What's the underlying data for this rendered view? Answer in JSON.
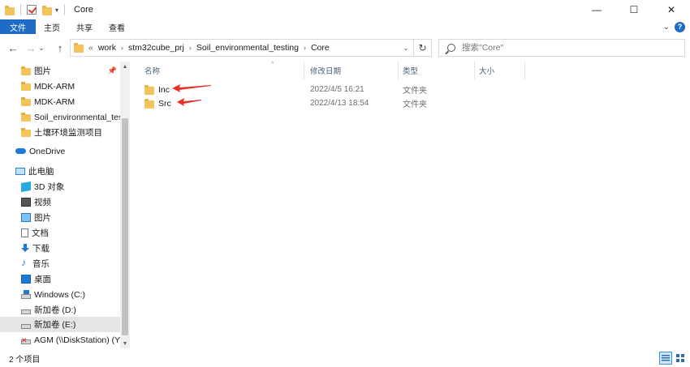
{
  "window": {
    "title": "Core",
    "controls": {
      "minimize": "—",
      "maximize": "☐",
      "close": "✕"
    }
  },
  "ribbon": {
    "tabs": [
      "文件",
      "主页",
      "共享",
      "查看"
    ],
    "expand": "⌄",
    "help": "?"
  },
  "nav": {
    "back": "←",
    "forward": "→",
    "recent": "⌄",
    "up": "↑",
    "breadcrumb_prefix": "«",
    "breadcrumb": [
      "work",
      "stm32cube_prj",
      "Soil_environmental_testing",
      "Core"
    ],
    "breadcrumb_sep": "›",
    "dropdown": "⌄",
    "refresh": "↻"
  },
  "search": {
    "placeholder": "搜索\"Core\""
  },
  "sidebar": {
    "items": [
      {
        "label": "图片",
        "icon": "pictures-folder-icon",
        "pinned": true
      },
      {
        "label": "MDK-ARM",
        "icon": "folder-icon"
      },
      {
        "label": "MDK-ARM",
        "icon": "folder-icon"
      },
      {
        "label": "Soil_environmental_tes",
        "icon": "folder-icon"
      },
      {
        "label": "土壤环境监测项目",
        "icon": "folder-icon"
      },
      {
        "label": "OneDrive",
        "icon": "cloud-icon"
      },
      {
        "label": "此电脑",
        "icon": "computer-icon"
      },
      {
        "label": "3D 对象",
        "icon": "3d-objects-icon"
      },
      {
        "label": "视频",
        "icon": "video-icon"
      },
      {
        "label": "图片",
        "icon": "pictures-icon"
      },
      {
        "label": "文档",
        "icon": "documents-icon"
      },
      {
        "label": "下载",
        "icon": "download-icon"
      },
      {
        "label": "音乐",
        "icon": "music-icon"
      },
      {
        "label": "桌面",
        "icon": "desktop-icon"
      },
      {
        "label": "Windows (C:)",
        "icon": "windows-drive-icon"
      },
      {
        "label": "新加卷 (D:)",
        "icon": "drive-icon"
      },
      {
        "label": "新加卷 (E:)",
        "icon": "drive-icon",
        "hovered": true
      },
      {
        "label": "AGM (\\\\DiskStation) (Y:)",
        "icon": "network-drive-disconnected-icon"
      }
    ],
    "pin_glyph": "📌",
    "scroll_up": "▲",
    "scroll_down": "▼"
  },
  "columns": {
    "name": "名称",
    "modified": "修改日期",
    "type": "类型",
    "size": "大小",
    "sort_indicator": "^"
  },
  "files": [
    {
      "name": "Inc",
      "modified": "2022/4/5 16:21",
      "type": "文件夹",
      "size": ""
    },
    {
      "name": "Src",
      "modified": "2022/4/13 18:54",
      "type": "文件夹",
      "size": ""
    }
  ],
  "annotation_color": "#e8312a",
  "status": {
    "count": "2 个项目"
  }
}
